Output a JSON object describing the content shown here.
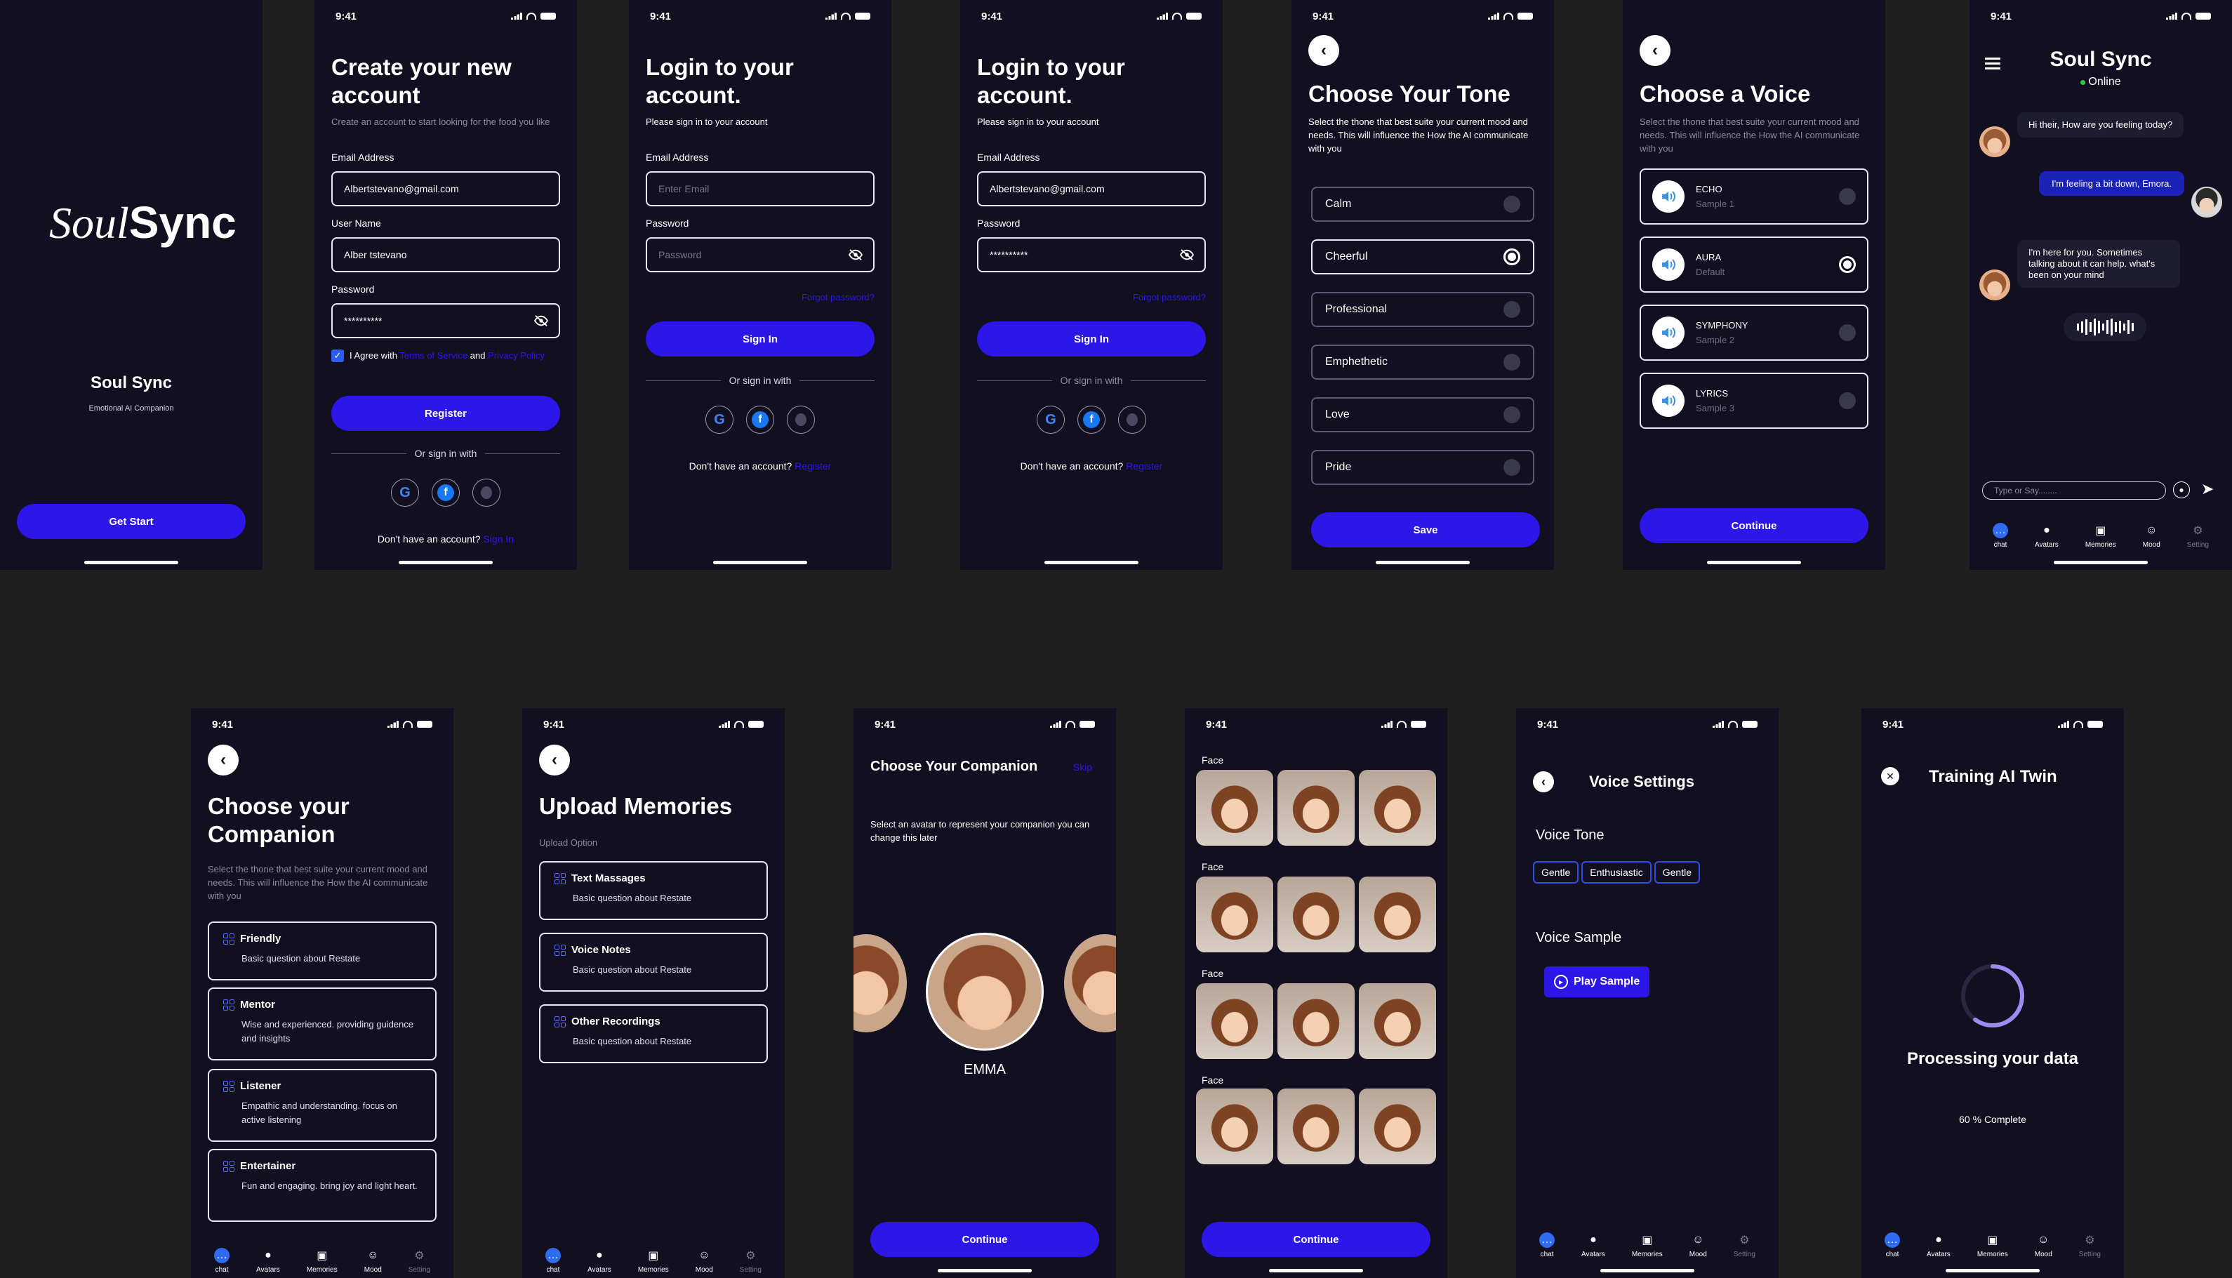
{
  "status_time": "9:41",
  "splash": {
    "logo_soul": "Soul",
    "logo_sync": "Sync",
    "app_name": "Soul Sync",
    "tagline": "Emotional AI Companion",
    "cta": "Get Start"
  },
  "register": {
    "title": "Create your new account",
    "subtitle": "Create an account to start looking for the food you like",
    "email_label": "Email Address",
    "email_value": "Albertstevano@gmail.com",
    "username_label": "User Name",
    "username_value": "Alber tstevano",
    "password_label": "Password",
    "password_value": "**********",
    "agree_prefix": "I Agree with",
    "terms": "Terms of Service",
    "and": "and",
    "privacy": "Privacy Policy",
    "button": "Register",
    "or_text": "Or sign in with",
    "footer_prefix": "Don't have an account?",
    "footer_link": "Sign In"
  },
  "login_empty": {
    "title": "Login to your account.",
    "subtitle": "Please sign in to your account",
    "email_label": "Email Address",
    "email_placeholder": "Enter Email",
    "password_label": "Password",
    "password_placeholder": "Password",
    "forgot": "Forgot password?",
    "button": "Sign In",
    "or_text": "Or sign in with",
    "footer_prefix": "Don't have an account?",
    "footer_link": "Register"
  },
  "login_filled": {
    "title": "Login to your account.",
    "subtitle": "Please sign in to your account",
    "email_label": "Email Address",
    "email_value": "Albertstevano@gmail.com",
    "password_label": "Password",
    "password_value": "**********",
    "forgot": "Forgot password?",
    "button": "Sign In",
    "or_text": "Or sign in with",
    "footer_prefix": "Don't have an account?",
    "footer_link": "Register"
  },
  "tone": {
    "title": "Choose Your Tone",
    "subtitle": "Select the thone that best suite your current mood and needs. This will influence the How the AI communicate with you",
    "options": [
      "Calm",
      "Cheerful",
      "Professional",
      "Emphethetic",
      "Love",
      "Pride"
    ],
    "selected": "Cheerful",
    "button": "Save"
  },
  "voice": {
    "title": "Choose a Voice",
    "subtitle": "Select the thone that best suite your current mood and needs. This will influence the How the AI communicate with you",
    "options": [
      {
        "name": "ECHO",
        "sub": "Sample 1"
      },
      {
        "name": "AURA",
        "sub": "Default"
      },
      {
        "name": "SYMPHONY",
        "sub": "Sample 2"
      },
      {
        "name": "LYRICS",
        "sub": "Sample 3"
      }
    ],
    "selected": "AURA",
    "button": "Continue"
  },
  "chat": {
    "title": "Soul Sync",
    "status": "Online",
    "msg1": "Hi their, How are you feeling today?",
    "msg2": "I'm feeling a bit down, Emora.",
    "msg3": "I'm here for you. Sometimes talking about it can help. what's been on your mind",
    "input_placeholder": "Type or Say........"
  },
  "tabs": [
    "chat",
    "Avatars",
    "Memories",
    "Mood",
    "Setting"
  ],
  "companion": {
    "title": "Choose your Companion",
    "subtitle": "Select the thone that best suite your current mood and needs. This will influence the How the AI communicate with you",
    "items": [
      {
        "title": "Friendly",
        "desc": "Basic question about Restate"
      },
      {
        "title": "Mentor",
        "desc": "Wise and experienced. providing guidence and insights"
      },
      {
        "title": "Listener",
        "desc": "Empathic and understanding. focus on active listening"
      },
      {
        "title": "Entertainer",
        "desc": "Fun and engaging. bring joy and light heart."
      }
    ]
  },
  "memories": {
    "title": "Upload Memories",
    "section": "Upload Option",
    "items": [
      {
        "title": "Text Massages",
        "desc": "Basic question about Restate"
      },
      {
        "title": "Voice Notes",
        "desc": "Basic question about Restate"
      },
      {
        "title": "Other Recordings",
        "desc": "Basic question about Restate"
      }
    ]
  },
  "avatar_pick": {
    "title": "Choose Your Companion",
    "skip": "Skip",
    "subtitle": "Select  an  avatar to represent  your companion you can change this later",
    "name": "EMMA",
    "button": "Continue"
  },
  "faces": {
    "section_label": "Face",
    "button": "Continue"
  },
  "voice_settings": {
    "title": "Voice Settings",
    "tone_label": "Voice Tone",
    "chips": [
      "Gentle",
      "Enthusiastic",
      "Gentle"
    ],
    "sample_label": "Voice Sample",
    "play": "Play Sample"
  },
  "training": {
    "title": "Training AI Twin",
    "processing": "Processing your data",
    "progress_text": "60 % Complete",
    "progress": 0.6
  },
  "colors": {
    "bg": "#121020",
    "accent": "#2c16e8",
    "canvas": "#1f1f1f"
  }
}
